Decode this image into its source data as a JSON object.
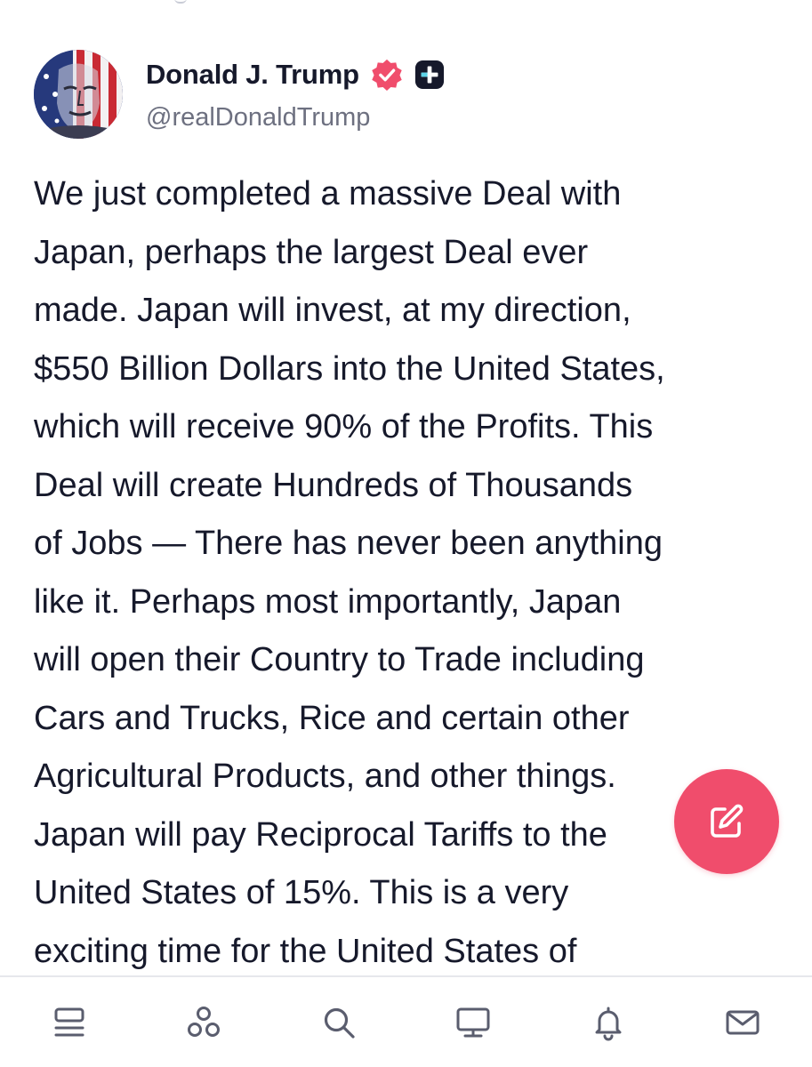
{
  "post": {
    "author": {
      "display_name": "Donald J. Trump",
      "handle": "@realDonaldTrump",
      "verified": true
    },
    "body": "We just completed a massive Deal with\nJapan, perhaps the largest Deal ever\nmade. Japan will invest, at my direction,\n$550 Billion Dollars into the United States,\nwhich will receive 90% of the Profits. This\nDeal will create Hundreds of Thousands\nof Jobs — There has never been anything\nlike it. Perhaps most importantly, Japan\nwill open their Country to Trade including\nCars and Trucks, Rice and certain other\nAgricultural Products, and other things.\nJapan will pay Reciprocal Tariffs to the\nUnited States of 15%. This is a very\nexciting time for the United States of"
  },
  "icons": {
    "verified": "verified-badge-icon",
    "plus_badge": "plus-badge-icon",
    "compose": "compose-pencil-icon",
    "nav": [
      "feed-icon",
      "groups-icon",
      "search-icon",
      "tv-icon",
      "bell-icon",
      "mail-icon"
    ]
  },
  "colors": {
    "accent": "#f04d6c",
    "text": "#16192b",
    "muted": "#6d7080",
    "icon": "#5a5d6e"
  }
}
